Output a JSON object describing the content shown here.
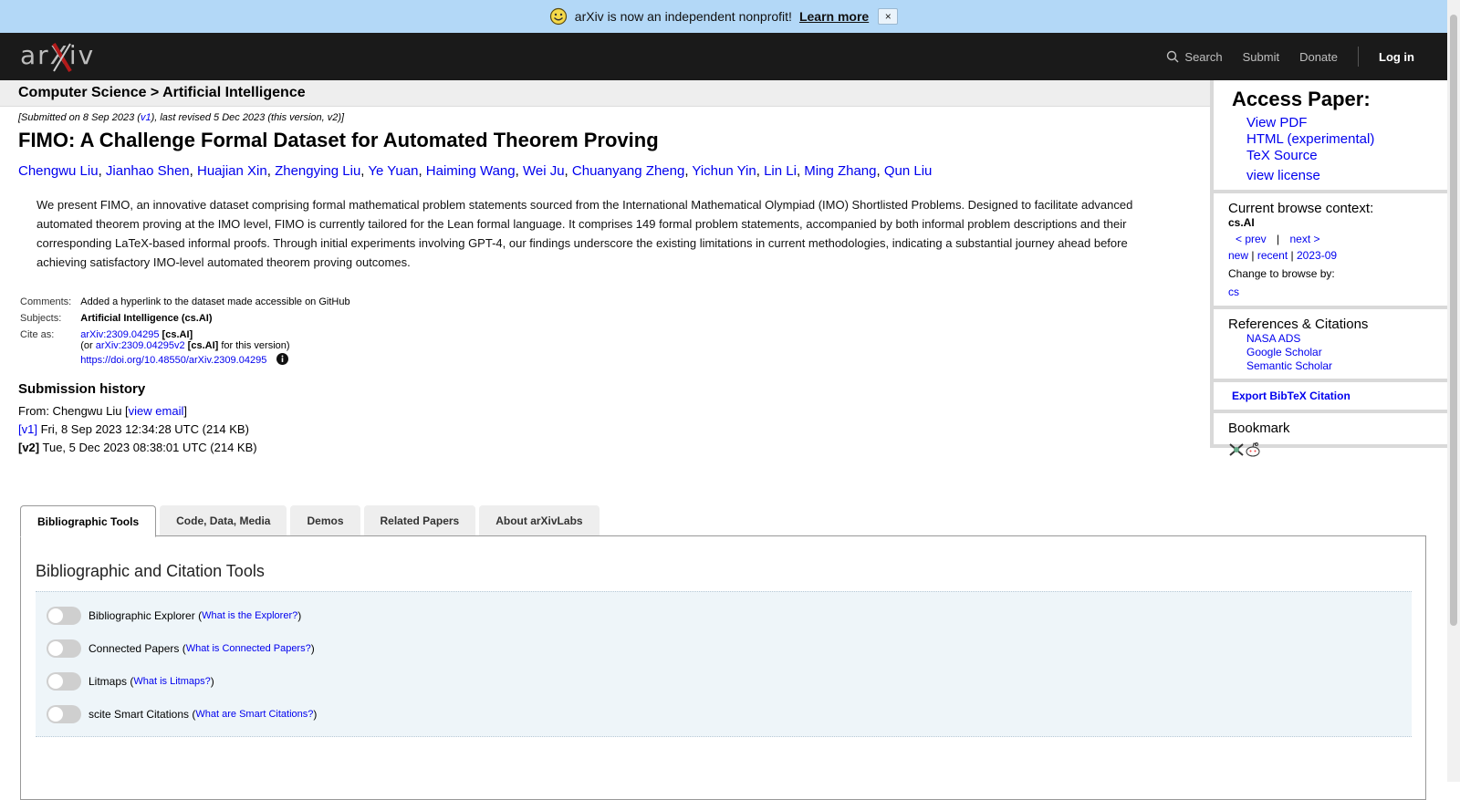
{
  "banner": {
    "message": "arXiv is now an independent nonprofit!",
    "link": "Learn more",
    "close": "×",
    "color": "#b3d8f7"
  },
  "header": {
    "logo_text": "arXiv",
    "nav": {
      "search": "Search",
      "submit": "Submit",
      "donate": "Donate",
      "login": "Log in"
    }
  },
  "breadcrumb": "Computer Science > Artificial Intelligence",
  "paper": {
    "dateline": {
      "prefix": "[Submitted on 8 Sep 2023 (",
      "v1": "v1",
      "suffix": "), last revised 5 Dec 2023 (this version, v2)]"
    },
    "title": "FIMO: A Challenge Formal Dataset for Automated Theorem Proving",
    "authors": [
      "Chengwu Liu",
      "Jianhao Shen",
      "Huajian Xin",
      "Zhengying Liu",
      "Ye Yuan",
      "Haiming Wang",
      "Wei Ju",
      "Chuanyang Zheng",
      "Yichun Yin",
      "Lin Li",
      "Ming Zhang",
      "Qun Liu"
    ],
    "abstract": "We present FIMO, an innovative dataset comprising formal mathematical problem statements sourced from the International Mathematical Olympiad (IMO) Shortlisted Problems. Designed to facilitate advanced automated theorem proving at the IMO level, FIMO is currently tailored for the Lean formal language. It comprises 149 formal problem statements, accompanied by both informal problem descriptions and their corresponding LaTeX-based informal proofs. Through initial experiments involving GPT-4, our findings underscore the existing limitations in current methodologies, indicating a substantial journey ahead before achieving satisfactory IMO-level automated theorem proving outcomes.",
    "meta": {
      "comments_label": "Comments:",
      "comments": "Added a hyperlink to the dataset made accessible on GitHub",
      "subjects_label": "Subjects:",
      "subjects": "Artificial Intelligence (cs.AI)",
      "cite_label": "Cite as:",
      "cite_id": "arXiv:2309.04295",
      "cite_cat": "[cs.AI]",
      "cite_or": "(or ",
      "cite_v2": "arXiv:2309.04295v2",
      "cite_v2_cat": "[cs.AI]",
      "cite_v2_suffix": " for this version)",
      "doi": "https://doi.org/10.48550/arXiv.2309.04295"
    },
    "history": {
      "title": "Submission history",
      "from_prefix": "From: Chengwu Liu [",
      "view_email": "view email",
      "from_suffix": "]",
      "v1_label": "[v1]",
      "v1_text": " Fri, 8 Sep 2023 12:34:28 UTC (214 KB)",
      "v2_label": "[v2]",
      "v2_text": " Tue, 5 Dec 2023 08:38:01 UTC (214 KB)"
    }
  },
  "sidebar": {
    "access_title": "Access Paper:",
    "access_links": [
      "View PDF",
      "HTML (experimental)",
      "TeX Source"
    ],
    "license": "view license",
    "context_title": "Current browse context:",
    "context": "cs.AI",
    "prev": "< prev",
    "divider": "|",
    "next": "next >",
    "new": "new",
    "recent": "recent",
    "month": "2023-09",
    "change_browse": "Change to browse by:",
    "browse_cs": "cs",
    "refs_title": "References & Citations",
    "refs": [
      "NASA ADS",
      "Google Scholar",
      "Semantic Scholar"
    ],
    "bibtex": "Export BibTeX Citation",
    "bookmark_title": "Bookmark"
  },
  "tabs": [
    "Bibliographic Tools",
    "Code, Data, Media",
    "Demos",
    "Related Papers",
    "About arXivLabs"
  ],
  "tools": {
    "title": "Bibliographic and Citation Tools",
    "items": [
      {
        "label": "Bibliographic Explorer",
        "link": "What is the Explorer?"
      },
      {
        "label": "Connected Papers",
        "link": "What is Connected Papers?"
      },
      {
        "label": "Litmaps",
        "link": "What is Litmaps?"
      },
      {
        "label": "scite Smart Citations",
        "link": "What are Smart Citations?"
      }
    ]
  }
}
